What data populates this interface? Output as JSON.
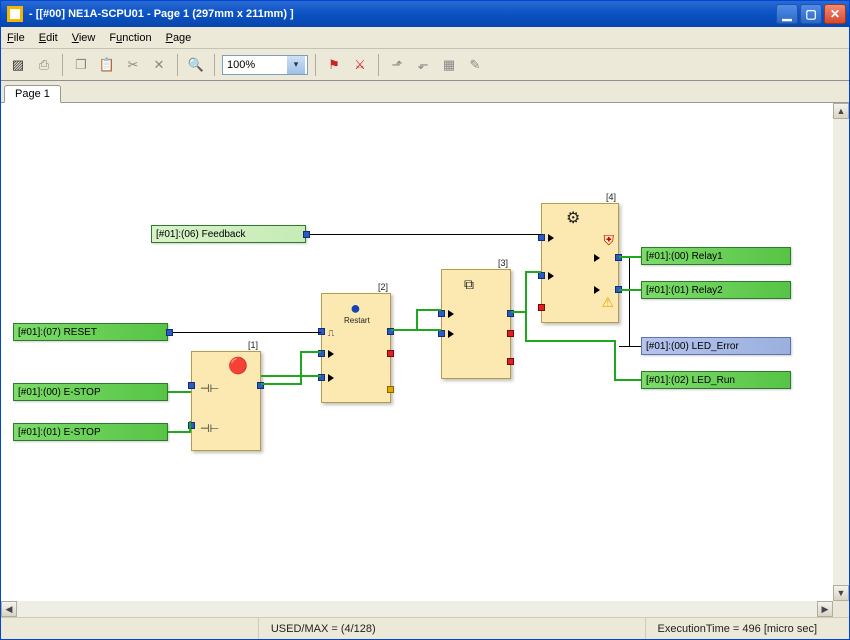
{
  "title": " - [[#00] NE1A-SCPU01 - Page 1 (297mm x 211mm) ]",
  "menu": {
    "file": "File",
    "edit": "Edit",
    "view": "View",
    "function": "Function",
    "page": "Page"
  },
  "toolbar": {
    "zoom": "100%"
  },
  "tabs": [
    "Page 1"
  ],
  "inputs": {
    "feedback": "[#01]:(06) Feedback",
    "reset": "[#01]:(07) RESET",
    "estop0": "[#01]:(00) E-STOP",
    "estop1": "[#01]:(01) E-STOP"
  },
  "outputs": {
    "relay1": "[#01]:(00) Relay1",
    "relay2": "[#01]:(01) Relay2",
    "led_error": "[#01]:(00) LED_Error",
    "led_run": "[#01]:(02) LED_Run"
  },
  "blocks": {
    "b1": {
      "num": "[1]"
    },
    "b2": {
      "num": "[2]",
      "label": "Restart"
    },
    "b3": {
      "num": "[3]"
    },
    "b4": {
      "num": "[4]"
    }
  },
  "status": {
    "usedmax": "USED/MAX = (4/128)",
    "exectime": "ExecutionTime = 496 [micro sec]"
  }
}
